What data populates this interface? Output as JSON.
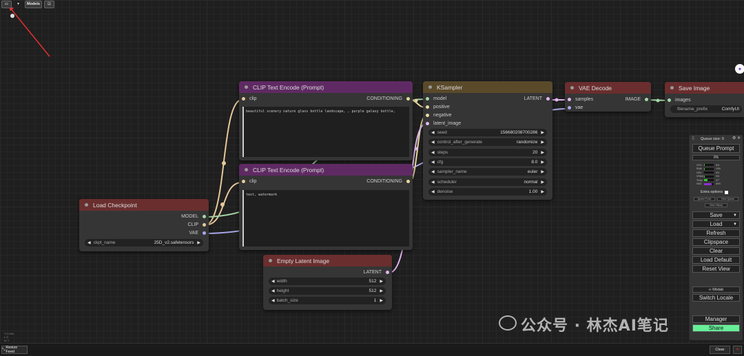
{
  "toolbar": {
    "models_label": "Models"
  },
  "colors": {
    "accent_red": "#e03030",
    "clip_header": "#5f2a63",
    "ksampler_header": "#5a4a2a",
    "red_header": "#6a2e2e",
    "wire_clip": "#e8c89a",
    "wire_model": "#a5d6a7",
    "wire_cond": "#e8d8a0",
    "wire_latent": "#e3b6f0",
    "wire_vae": "#a8a8e8"
  },
  "nodes": {
    "clip_pos": {
      "title": "CLIP Text Encode (Prompt)",
      "in_clip": "clip",
      "out_cond": "CONDITIONING",
      "text": "beautiful scenery nature glass bottle landscape, , purple galaxy bottle,"
    },
    "clip_neg": {
      "title": "CLIP Text Encode (Prompt)",
      "in_clip": "clip",
      "out_cond": "CONDITIONING",
      "text": "text, watermark"
    },
    "checkpoint": {
      "title": "Load Checkpoint",
      "out_model": "MODEL",
      "out_clip": "CLIP",
      "out_vae": "VAE",
      "w_ckpt_label": "ckpt_name",
      "w_ckpt_value": "25D_v2.safetensors"
    },
    "latent": {
      "title": "Empty Latent Image",
      "out_latent": "LATENT",
      "widgets": [
        {
          "label": "width",
          "value": "512"
        },
        {
          "label": "height",
          "value": "512"
        },
        {
          "label": "batch_size",
          "value": "1"
        }
      ]
    },
    "ksampler": {
      "title": "KSampler",
      "in_model": "model",
      "in_positive": "positive",
      "in_negative": "negative",
      "in_latent": "latent_image",
      "out_latent": "LATENT",
      "widgets": [
        {
          "label": "seed",
          "value": "156680208700286"
        },
        {
          "label": "control_after_generate",
          "value": "randomize"
        },
        {
          "label": "steps",
          "value": "20"
        },
        {
          "label": "cfg",
          "value": "8.0"
        },
        {
          "label": "sampler_name",
          "value": "euler"
        },
        {
          "label": "scheduler",
          "value": "normal"
        },
        {
          "label": "denoise",
          "value": "1.00"
        }
      ]
    },
    "vae": {
      "title": "VAE Decode",
      "in_samples": "samples",
      "in_vae": "vae",
      "out_image": "IMAGE"
    },
    "save": {
      "title": "Save Image",
      "in_images": "images",
      "w_label": "filename_prefix",
      "w_value": "ComfyUI"
    }
  },
  "panel": {
    "title": "Queue size: 0",
    "queue_prompt": "Queue Prompt",
    "progress": "0%",
    "stats": [
      {
        "label": "CPU",
        "value": "5%",
        "level": 0.05
      },
      {
        "label": "RAM",
        "value": "10%",
        "level": 0.1
      },
      {
        "label": "GPU",
        "value": "0%",
        "level": 0.0
      },
      {
        "label": "VRAM",
        "value": "3%",
        "level": 0.03
      },
      {
        "label": "Temp",
        "value": "37°",
        "level": 0.37
      },
      {
        "label": "HDD",
        "value": "80%",
        "level": 0.8
      }
    ],
    "extra_options": "Extra options",
    "queue_front": "Queue Front",
    "view_queue": "View Queue",
    "view_history": "View History",
    "buttons": [
      "Save",
      "Load",
      "Refresh",
      "Clipspace",
      "Clear",
      "Load Default",
      "Reset View"
    ],
    "mixlab": "∞ Mixlab",
    "switch_locale": "Switch Locale",
    "manager": "Manager",
    "share": "Share"
  },
  "bottom": {
    "resize_feed": "Resize Feed",
    "clear": "Clear",
    "close": "✕"
  },
  "corner_info": [
    "T: 0.00s",
    "I: 0",
    "N: 7"
  ],
  "watermark": "公众号 · 林杰AI笔记"
}
